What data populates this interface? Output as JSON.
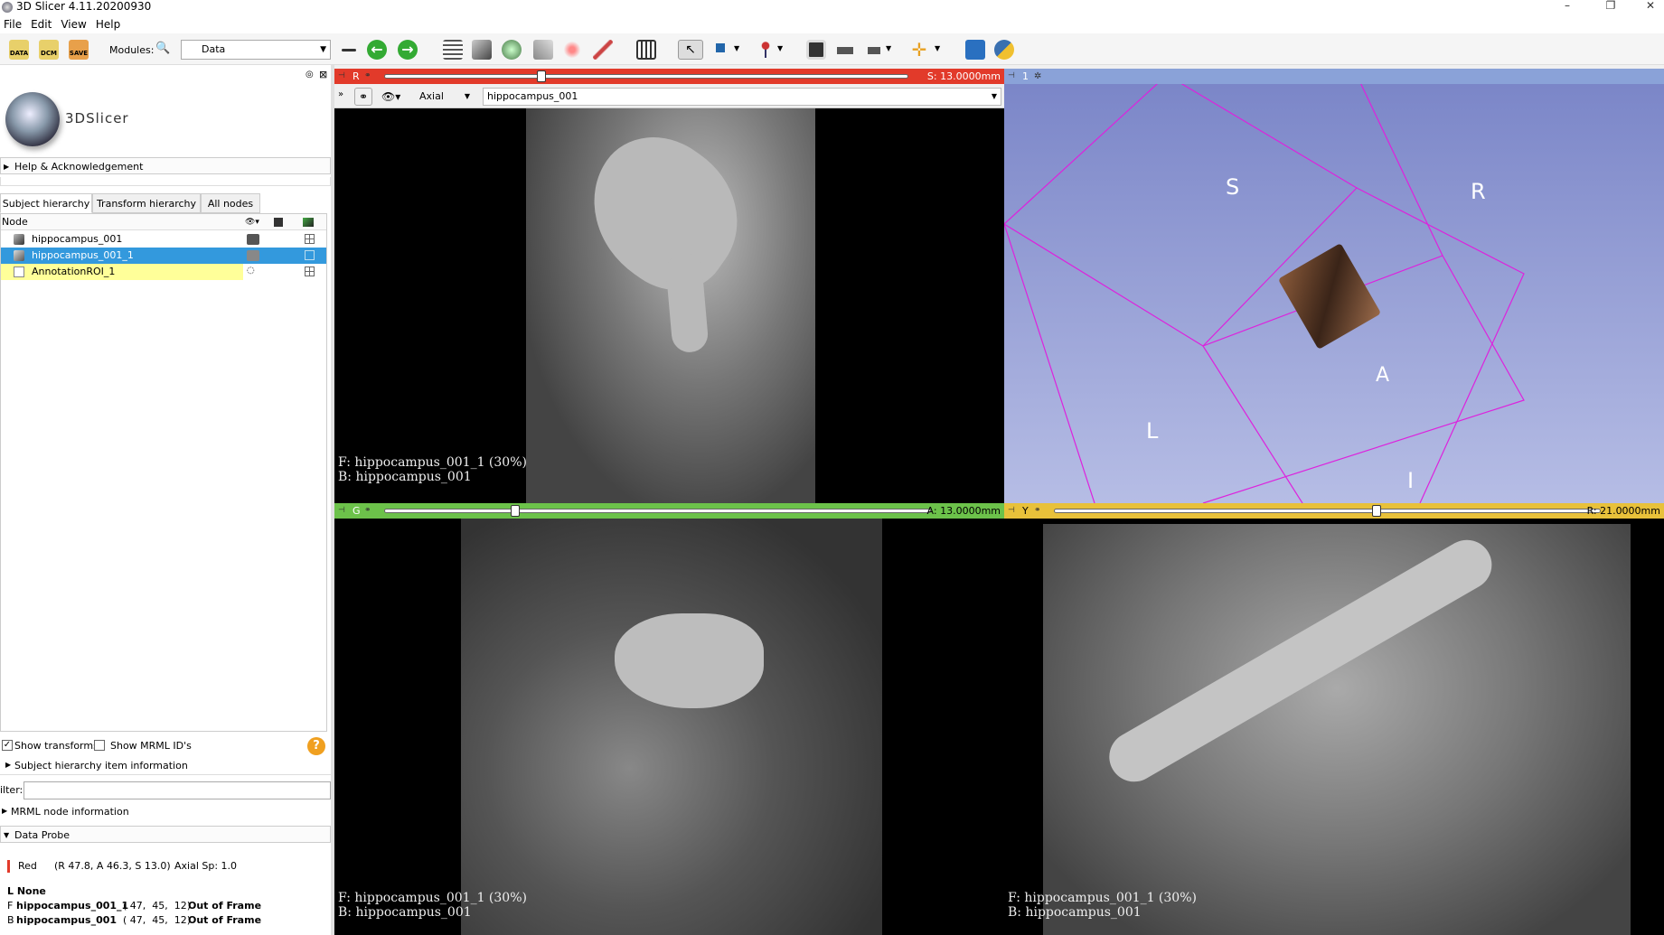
{
  "window": {
    "title": "3D Slicer 4.11.20200930",
    "minimize": "–",
    "restore": "❐",
    "close": "✕"
  },
  "menu": [
    "File",
    "Edit",
    "View",
    "Help"
  ],
  "toolbar": {
    "data_label": "DATA",
    "dcm_label": "DCM",
    "save_label": "SAVE",
    "modules_label": "Modules:",
    "module_selected": "Data"
  },
  "left": {
    "logo_text": "3DSlicer",
    "help_section": "Help & Acknowledgement",
    "tabs": [
      "Subject hierarchy",
      "Transform hierarchy",
      "All nodes"
    ],
    "tree_header": "Node",
    "nodes": [
      {
        "name": "hippocampus_001"
      },
      {
        "name": "hippocampus_001_1"
      },
      {
        "name": "AnnotationROI_1"
      }
    ],
    "show_transforms": "Show transforms",
    "show_mrml_ids": "Show MRML ID's",
    "subject_info": "Subject hierarchy item information",
    "filter_label": "ilter:",
    "mrml_info": "MRML node information",
    "data_probe": "Data Probe",
    "probe": {
      "view": "Red",
      "coords": "(R 47.8, A 46.3, S 13.0)",
      "spacing": "Axial Sp: 1.0",
      "l_layer": "L None",
      "f_layer_name": "hippocampus_001_1",
      "f_layer_ijk": "( 47,  45,  12)",
      "f_layer_status": "Out of Frame",
      "b_layer_name": "hippocampus_001",
      "b_layer_ijk": "( 47,  45,  12)",
      "b_layer_status": "Out of Frame",
      "f_prefix": "F",
      "b_prefix": "B"
    }
  },
  "views": {
    "red": {
      "letter": "R",
      "offset": "S: 13.0000mm",
      "orientation": "Axial",
      "volume": "hippocampus_001",
      "fg": "F: hippocampus_001_1 (30%)",
      "bg": "B: hippocampus_001",
      "slider": 0.3
    },
    "threed": {
      "label": "1",
      "axes": {
        "S": "S",
        "R": "R",
        "A": "A",
        "L": "L",
        "I": "I"
      }
    },
    "green": {
      "letter": "G",
      "offset": "A: 13.0000mm",
      "fg": "F: hippocampus_001_1 (30%)",
      "bg": "B: hippocampus_001",
      "slider": 0.24
    },
    "yellow": {
      "letter": "Y",
      "offset": "R: 21.0000mm",
      "fg": "F: hippocampus_001_1 (30%)",
      "bg": "B: hippocampus_001",
      "slider": 0.59
    }
  },
  "colors": {
    "red": "#e23a2a",
    "green": "#6cc24a",
    "yellow": "#e8c13a",
    "selection": "#3399dd",
    "roi_highlight": "#ffff99",
    "box": "#dd22dd"
  }
}
